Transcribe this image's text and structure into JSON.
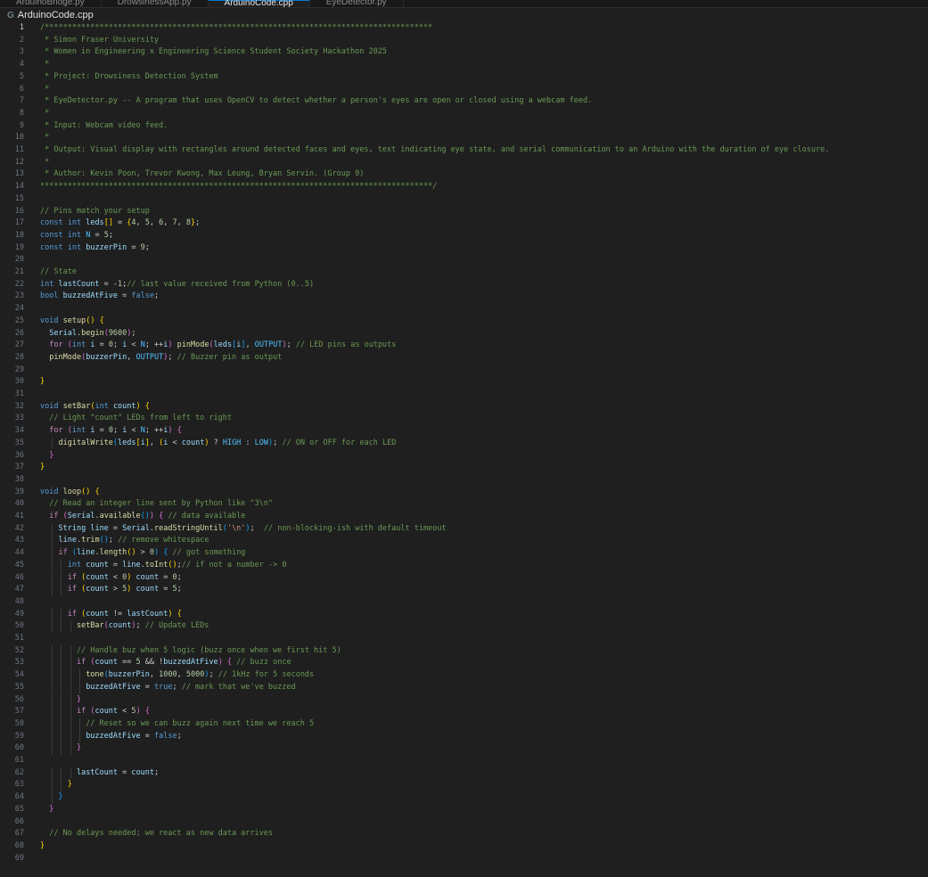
{
  "tabs": [
    {
      "label": "ArduinoBridge.py",
      "active": false
    },
    {
      "label": "DrowsinessApp.py",
      "active": false
    },
    {
      "label": "ArduinoCode.cpp",
      "active": true
    },
    {
      "label": "EyeDetector.py",
      "active": false
    }
  ],
  "breadcrumb": {
    "icon": "cpp-file-icon",
    "filename": "ArduinoCode.cpp"
  },
  "editor": {
    "current_line": 1,
    "lines": [
      "/*************************************************************************************",
      " * Simon Fraser University",
      " * Women in Engineering x Engineering Science Student Society Hackathon 2025",
      " *",
      " * Project: Drowsiness Detection System",
      " *",
      " * EyeDetector.py -- A program that uses OpenCV to detect whether a person's eyes are open or closed using a webcam feed.",
      " *",
      " * Input: Webcam video feed.",
      " *",
      " * Output: Visual display with rectangles around detected faces and eyes, text indicating eye state, and serial communication to an Arduino with the duration of eye closure.",
      " *",
      " * Author: Kevin Poon, Trevor Kwong, Max Leung, Bryan Servin. (Group 9)",
      "**************************************************************************************/",
      "",
      "// Pins match your setup",
      "const int leds[] = {4, 5, 6, 7, 8};",
      "const int N = 5;",
      "const int buzzerPin = 9;",
      "",
      "// State",
      "int lastCount = -1;// last value received from Python (0..5)",
      "bool buzzedAtFive = false;",
      "",
      "void setup() {",
      "  Serial.begin(9600);",
      "  for (int i = 0; i < N; ++i) pinMode(leds[i], OUTPUT); // LED pins as outputs",
      "  pinMode(buzzerPin, OUTPUT); // Buzzer pin as output",
      "",
      "}",
      "",
      "void setBar(int count) {",
      "  // Light \"count\" LEDs from left to right",
      "  for (int i = 0; i < N; ++i) {",
      "    digitalWrite(leds[i], (i < count) ? HIGH : LOW); // ON or OFF for each LED",
      "  }",
      "}",
      "",
      "void loop() {",
      "  // Read an integer line sent by Python like \"3\\n\"",
      "  if (Serial.available()) { // data available",
      "    String line = Serial.readStringUntil('\\n');  // non-blocking-ish with default timeout",
      "    line.trim(); // remove whitespace",
      "    if (line.length() > 0) { // got something",
      "      int count = line.toInt();// if not a number -> 0",
      "      if (count < 0) count = 0;",
      "      if (count > 5) count = 5;",
      "",
      "      if (count != lastCount) {",
      "        setBar(count); // Update LEDs",
      "",
      "        // Handle buz when 5 logic (buzz once when we first hit 5)",
      "        if (count == 5 && !buzzedAtFive) { // buzz once",
      "          tone(buzzerPin, 1000, 5000); // 1kHz for 5 seconds",
      "          buzzedAtFive = true; // mark that we've buzzed",
      "        }",
      "        if (count < 5) {",
      "          // Reset so we can buzz again next time we reach 5",
      "          buzzedAtFive = false;",
      "        }",
      "",
      "        lastCount = count;",
      "      }",
      "    }",
      "  }",
      "",
      "  // No delays needed; we react as new data arrives",
      "}",
      ""
    ]
  }
}
